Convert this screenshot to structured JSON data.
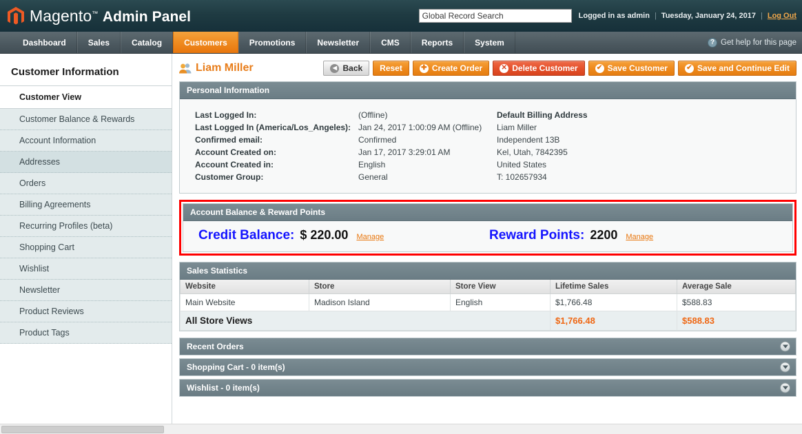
{
  "header": {
    "brand_magento": "Magento",
    "brand_tm": "™",
    "brand_admin": "Admin Panel",
    "search_placeholder": "Global Record Search",
    "search_value": "Global Record Search",
    "logged_in": "Logged in as admin",
    "sep": "|",
    "date": "Tuesday, January 24, 2017",
    "logout": "Log Out",
    "accent_orange": "#e8760d",
    "header_bg": "#1f3b42"
  },
  "nav": {
    "items": [
      {
        "label": "Dashboard",
        "active": false
      },
      {
        "label": "Sales",
        "active": false
      },
      {
        "label": "Catalog",
        "active": false
      },
      {
        "label": "Customers",
        "active": true
      },
      {
        "label": "Promotions",
        "active": false
      },
      {
        "label": "Newsletter",
        "active": false
      },
      {
        "label": "CMS",
        "active": false
      },
      {
        "label": "Reports",
        "active": false
      },
      {
        "label": "System",
        "active": false
      }
    ],
    "help_label": "Get help for this page",
    "help_icon": "question-mark-icon"
  },
  "sidebar": {
    "title": "Customer Information",
    "first_item": "Customer View",
    "items": [
      {
        "label": "Customer Balance & Rewards",
        "highlighted": false
      },
      {
        "label": "Account Information",
        "highlighted": false
      },
      {
        "label": "Addresses",
        "highlighted": true
      },
      {
        "label": "Orders",
        "highlighted": false
      },
      {
        "label": "Billing Agreements",
        "highlighted": false
      },
      {
        "label": "Recurring Profiles (beta)",
        "highlighted": false
      },
      {
        "label": "Shopping Cart",
        "highlighted": false
      },
      {
        "label": "Wishlist",
        "highlighted": false
      },
      {
        "label": "Newsletter",
        "highlighted": false
      },
      {
        "label": "Product Reviews",
        "highlighted": false
      },
      {
        "label": "Product Tags",
        "highlighted": false
      }
    ]
  },
  "main": {
    "page_title": "Liam Miller",
    "title_icon": "customer-icon",
    "buttons": [
      {
        "label": "Back",
        "style": "grey",
        "icon": "◀"
      },
      {
        "label": "Reset",
        "style": "orange",
        "icon": ""
      },
      {
        "label": "Create Order",
        "style": "orange",
        "icon": "✚"
      },
      {
        "label": "Delete Customer",
        "style": "red",
        "icon": "✕"
      },
      {
        "label": "Save Customer",
        "style": "orange",
        "icon": "✔"
      },
      {
        "label": "Save and Continue Edit",
        "style": "orange",
        "icon": "✔"
      }
    ],
    "personal_information": {
      "title": "Personal Information",
      "rows": [
        {
          "label": "Last Logged In:",
          "value": "(Offline)"
        },
        {
          "label": "Last Logged In (America/Los_Angeles):",
          "value": "Jan 24, 2017 1:00:09 AM (Offline)"
        },
        {
          "label": "Confirmed email:",
          "value": "Confirmed"
        },
        {
          "label": "Account Created on:",
          "value": "Jan 17, 2017 3:29:01 AM"
        },
        {
          "label": "Account Created in:",
          "value": "English"
        },
        {
          "label": "Customer Group:",
          "value": "General"
        }
      ],
      "billing": {
        "title": "Default Billing Address",
        "lines": [
          "Liam Miller",
          "Independent 13B",
          "Kel, Utah, 7842395",
          "United States",
          "T: 102657934"
        ]
      }
    },
    "balance_section": {
      "title": "Account Balance & Reward Points",
      "highlight_color": "#ff0000",
      "credit_label": "Credit Balance:",
      "credit_value": "$ 220.00",
      "credit_manage": "Manage",
      "reward_label": "Reward Points:",
      "reward_value": "2200",
      "reward_manage": "Manage"
    },
    "sales_statistics": {
      "title": "Sales Statistics",
      "columns": [
        "Website",
        "Store",
        "Store View",
        "Lifetime Sales",
        "Average Sale"
      ],
      "rows": [
        [
          "Main Website",
          "Madison Island",
          "English",
          "$1,766.48",
          "$588.83"
        ]
      ],
      "total_row": {
        "label": "All Store Views",
        "lifetime_sales": "$1,766.48",
        "average_sale": "$588.83",
        "total_color": "#ef6713"
      }
    },
    "collapsibles": [
      {
        "label": "Recent Orders",
        "icon": "chevron-down-icon"
      },
      {
        "label": "Shopping Cart - 0 item(s)",
        "icon": "chevron-down-icon"
      },
      {
        "label": "Wishlist - 0 item(s)",
        "icon": "chevron-down-icon"
      }
    ]
  }
}
